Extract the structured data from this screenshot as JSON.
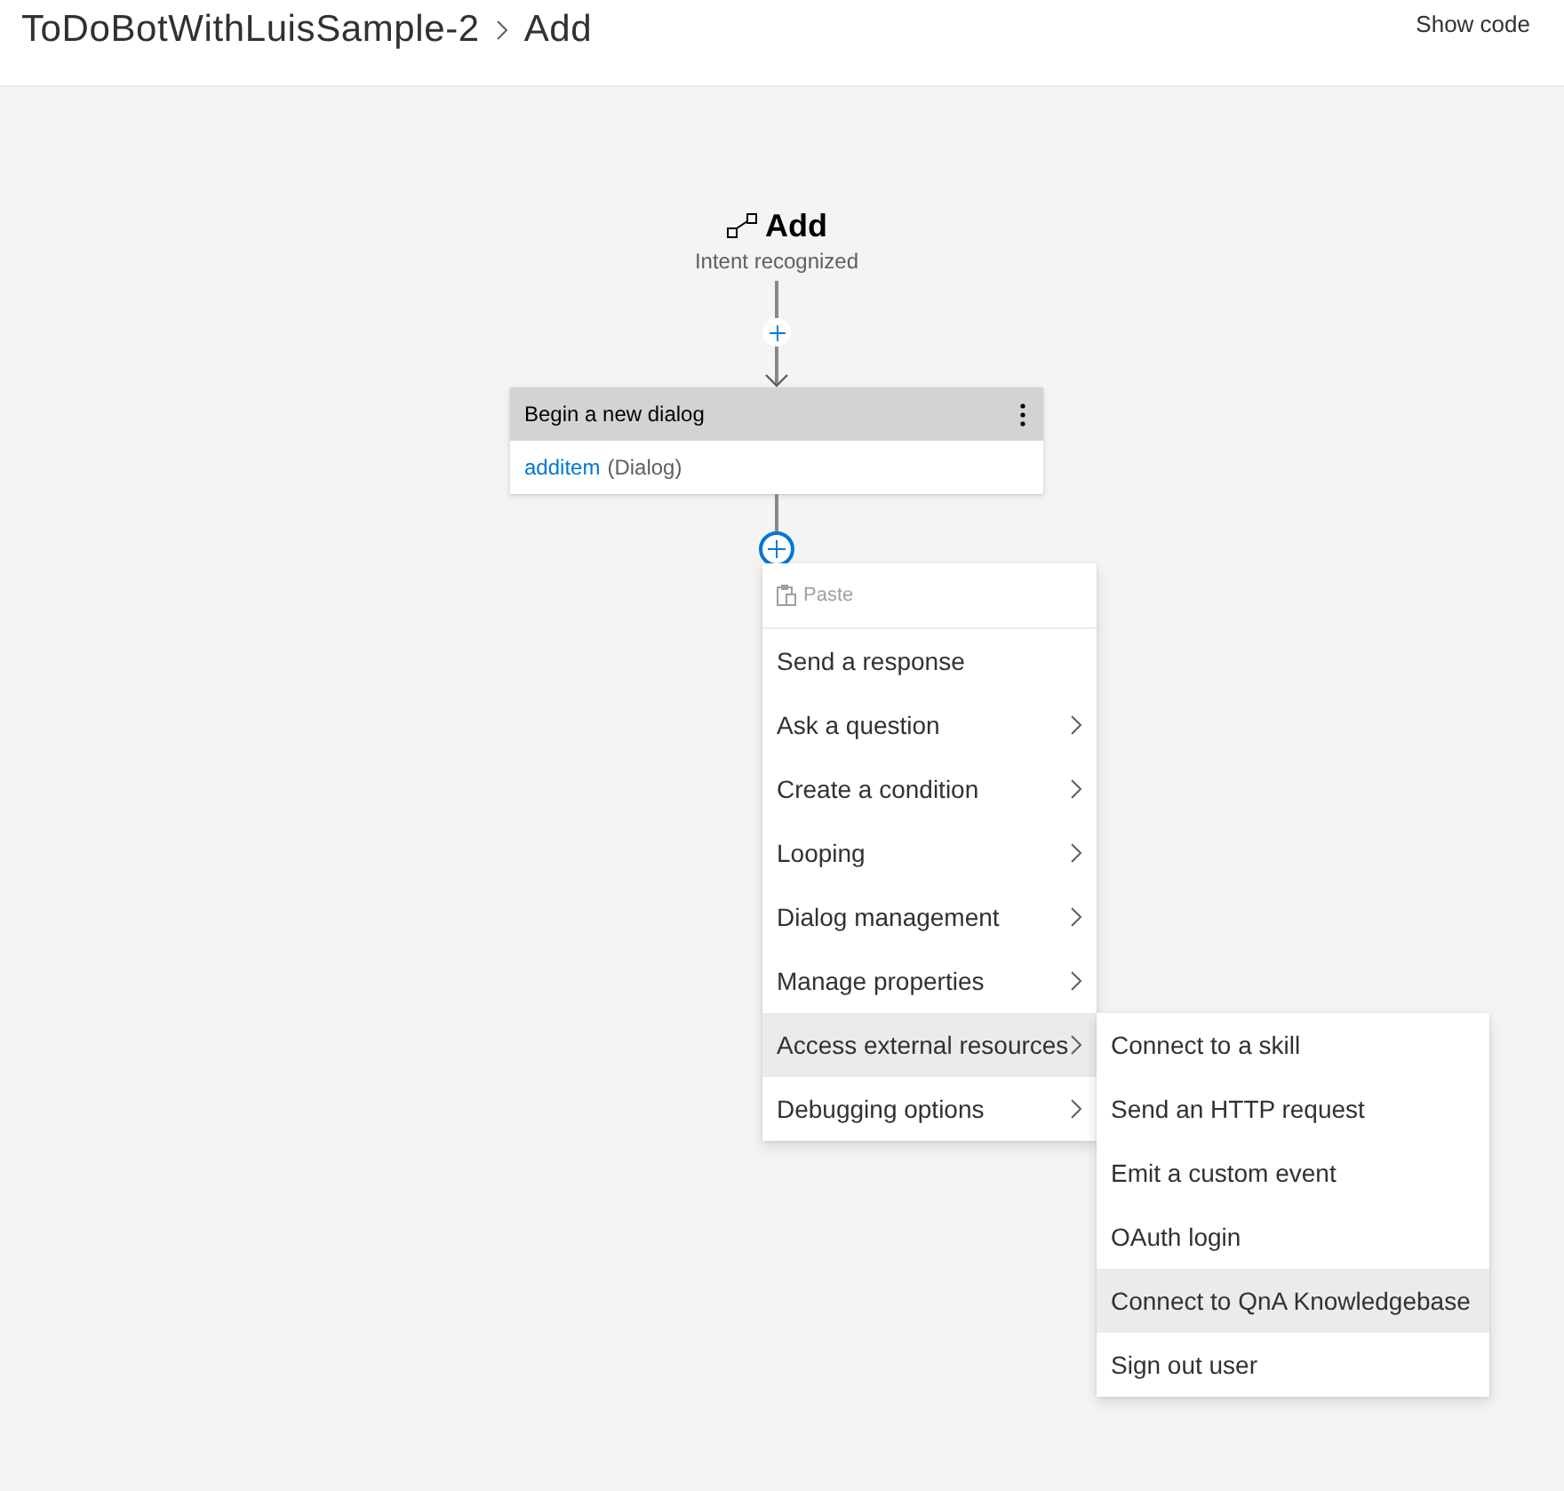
{
  "header": {
    "breadcrumb": [
      {
        "label": "ToDoBotWithLuisSample-2"
      },
      {
        "label": "Add"
      }
    ],
    "show_code": "Show code"
  },
  "trigger": {
    "title": "Add",
    "subtitle": "Intent recognized"
  },
  "action": {
    "title": "Begin a new dialog",
    "dialog_name": "additem",
    "dialog_type": "(Dialog)"
  },
  "menu": {
    "paste": {
      "label": "Paste",
      "disabled": true
    },
    "items": [
      {
        "label": "Send a response",
        "has_submenu": false,
        "selected": false
      },
      {
        "label": "Ask a question",
        "has_submenu": true,
        "selected": false
      },
      {
        "label": "Create a condition",
        "has_submenu": true,
        "selected": false
      },
      {
        "label": "Looping",
        "has_submenu": true,
        "selected": false
      },
      {
        "label": "Dialog management",
        "has_submenu": true,
        "selected": false
      },
      {
        "label": "Manage properties",
        "has_submenu": true,
        "selected": false
      },
      {
        "label": "Access external resources",
        "has_submenu": true,
        "selected": true,
        "submenu": [
          {
            "label": "Connect to a skill",
            "selected": false
          },
          {
            "label": "Send an HTTP request",
            "selected": false
          },
          {
            "label": "Emit a custom event",
            "selected": false
          },
          {
            "label": "OAuth login",
            "selected": false
          },
          {
            "label": "Connect to QnA Knowledgebase",
            "selected": true
          },
          {
            "label": "Sign out user",
            "selected": false
          }
        ]
      },
      {
        "label": "Debugging options",
        "has_submenu": true,
        "selected": false
      }
    ]
  }
}
